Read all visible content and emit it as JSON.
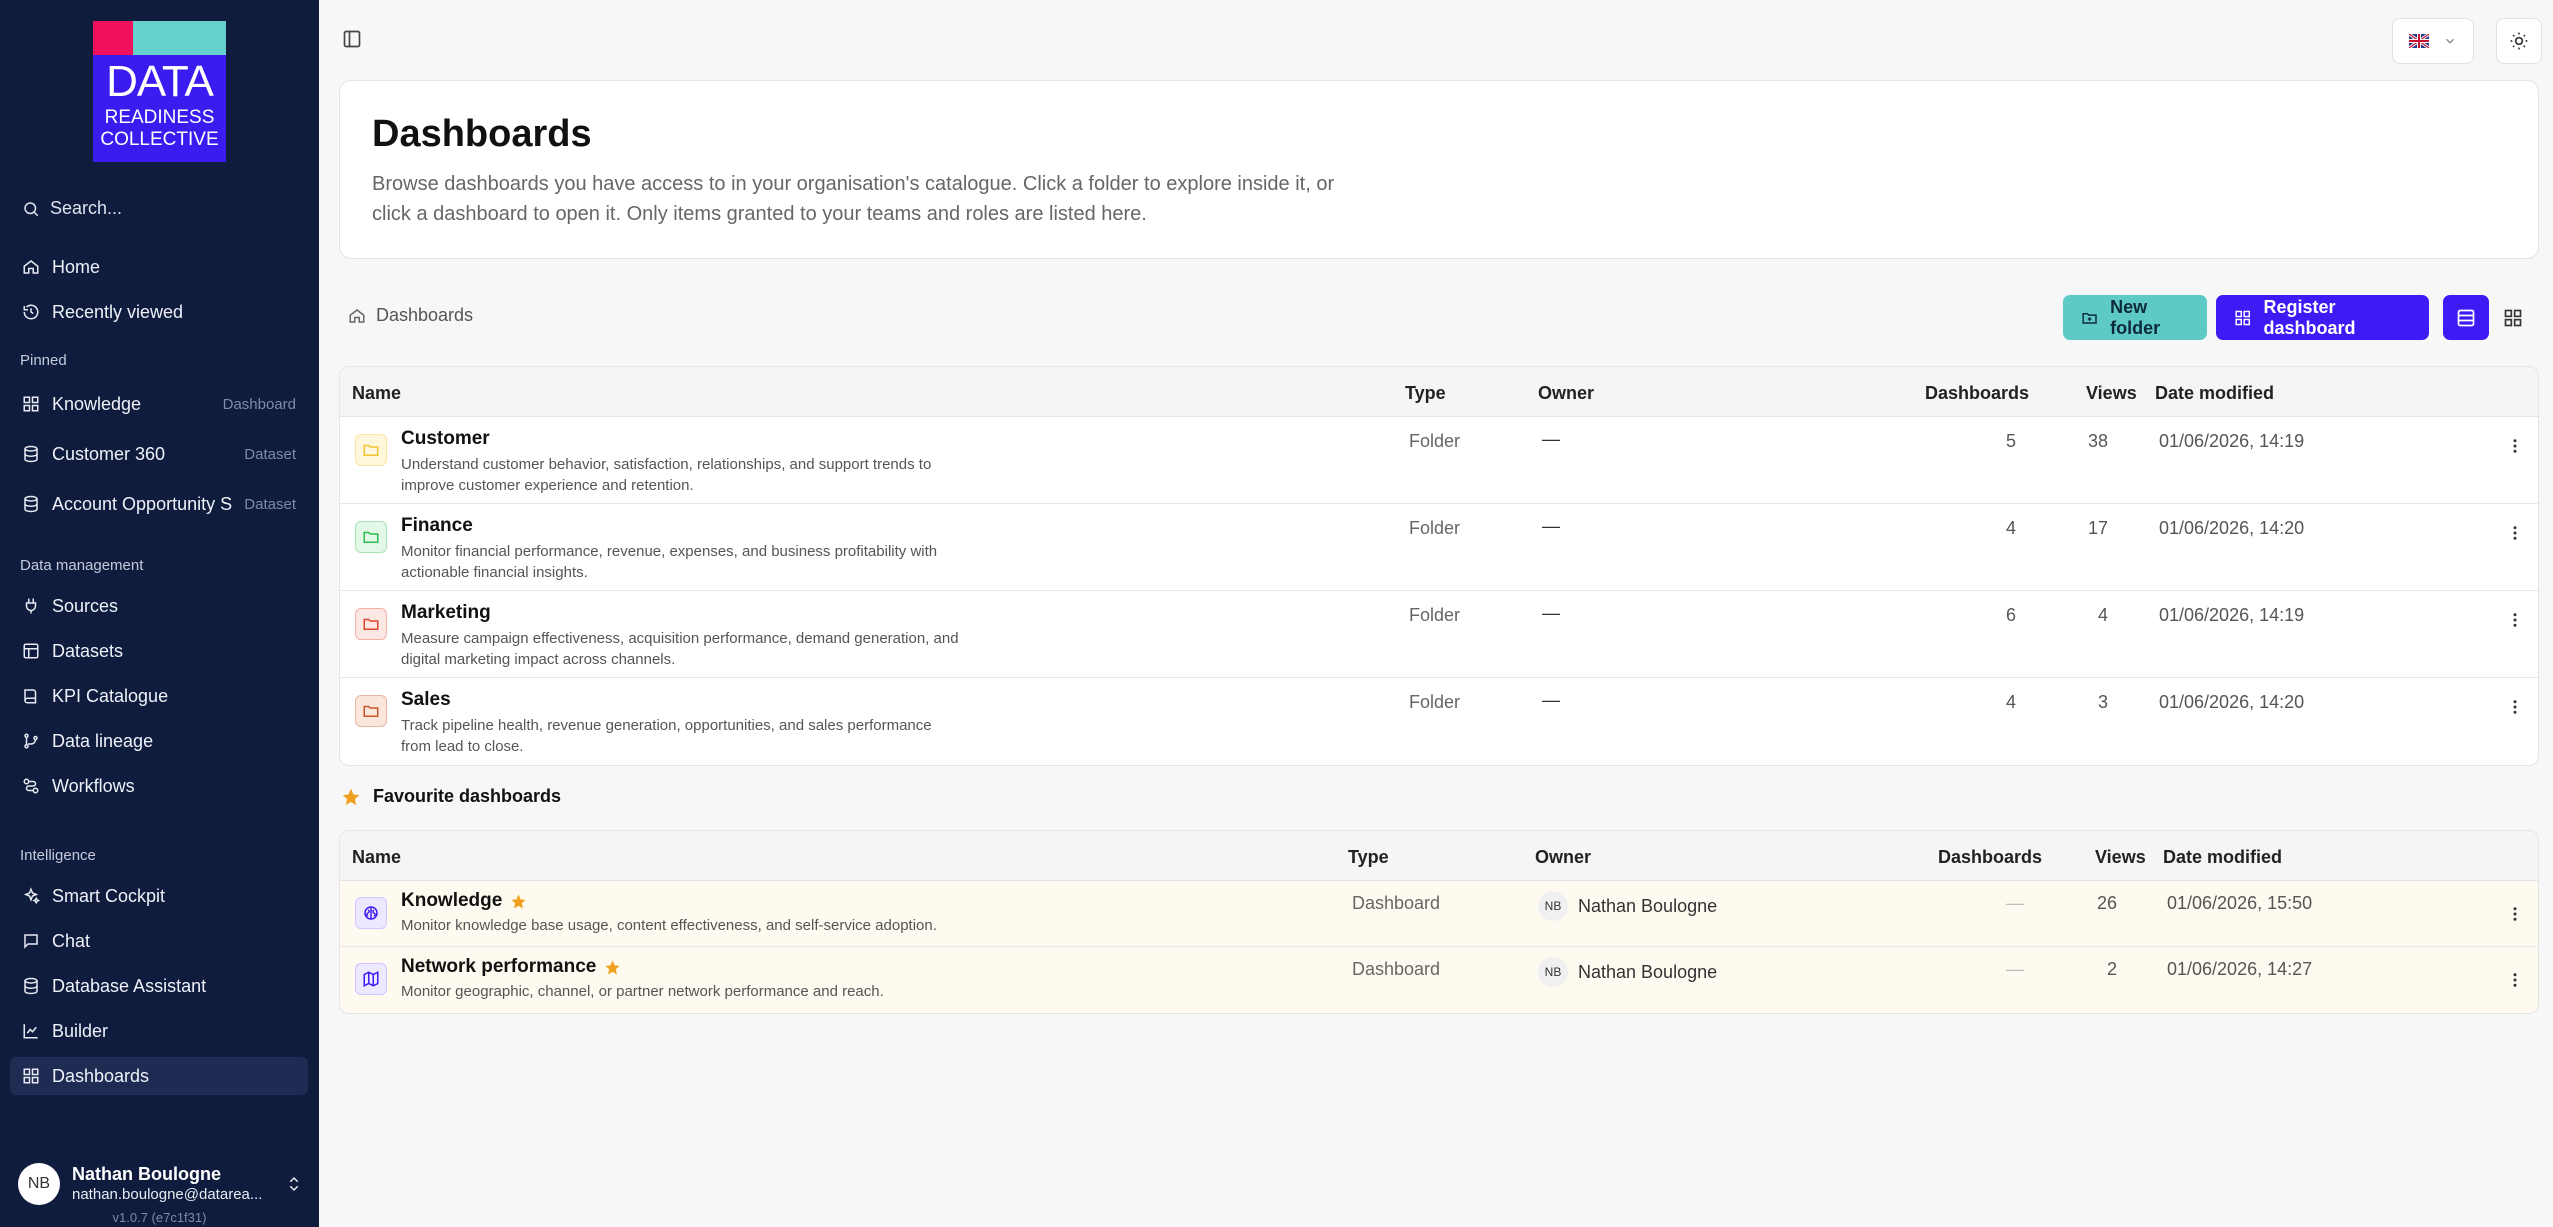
{
  "logo": {
    "line1": "DATA",
    "line2": "READINESS",
    "line3": "COLLECTIVE"
  },
  "sidebar": {
    "search_placeholder": "Search...",
    "top": [
      {
        "label": "Home",
        "icon": "home-icon"
      },
      {
        "label": "Recently viewed",
        "icon": "history-icon"
      }
    ],
    "pinned_label": "Pinned",
    "pinned": [
      {
        "label": "Knowledge",
        "sub": "Dashboard",
        "icon": "dashboard-icon"
      },
      {
        "label": "Customer 360",
        "sub": "Dataset",
        "icon": "database-icon"
      },
      {
        "label": "Account Opportunity S...",
        "sub": "Dataset",
        "icon": "database-icon"
      }
    ],
    "data_mgmt_label": "Data management",
    "data_mgmt": [
      {
        "label": "Sources",
        "icon": "plug-icon"
      },
      {
        "label": "Datasets",
        "icon": "table-icon"
      },
      {
        "label": "KPI Catalogue",
        "icon": "book-icon"
      },
      {
        "label": "Data lineage",
        "icon": "git-branch-icon"
      },
      {
        "label": "Workflows",
        "icon": "workflow-icon"
      }
    ],
    "intelligence_label": "Intelligence",
    "intelligence": [
      {
        "label": "Smart Cockpit",
        "icon": "sparkles-icon"
      },
      {
        "label": "Chat",
        "icon": "chat-icon"
      },
      {
        "label": "Database Assistant",
        "icon": "database-icon"
      },
      {
        "label": "Builder",
        "icon": "chart-icon"
      },
      {
        "label": "Dashboards",
        "icon": "dashboard-icon",
        "active": true
      }
    ],
    "user": {
      "initials": "NB",
      "name": "Nathan Boulogne",
      "email": "nathan.boulogne@datarea..."
    },
    "version": "v1.0.7 (e7c1f31)"
  },
  "header": {
    "title": "Dashboards",
    "description": "Browse dashboards you have access to in your organisation's catalogue. Click a folder to explore inside it, or click a dashboard to open it. Only items granted to your teams and roles are listed here."
  },
  "breadcrumb": "Dashboards",
  "actions": {
    "new_folder": "New folder",
    "register": "Register dashboard"
  },
  "columns": {
    "name": "Name",
    "type": "Type",
    "owner": "Owner",
    "dashboards": "Dashboards",
    "views": "Views",
    "modified": "Date modified"
  },
  "folders": [
    {
      "name": "Customer",
      "desc": "Understand customer behavior, satisfaction, relationships, and support trends to improve customer experience and retention.",
      "type": "Folder",
      "owner": "—",
      "dashboards": "5",
      "views": "38",
      "modified": "01/06/2026, 14:19",
      "color": "#f4c430",
      "bg": "#fff7dc"
    },
    {
      "name": "Finance",
      "desc": "Monitor financial performance, revenue, expenses, and business profitability with actionable financial insights.",
      "type": "Folder",
      "owner": "—",
      "dashboards": "4",
      "views": "17",
      "modified": "01/06/2026, 14:20",
      "color": "#2dbe4f",
      "bg": "#e4f8e8"
    },
    {
      "name": "Marketing",
      "desc": "Measure campaign effectiveness, acquisition performance, demand generation, and digital marketing impact across channels.",
      "type": "Folder",
      "owner": "—",
      "dashboards": "6",
      "views": "4",
      "modified": "01/06/2026, 14:19",
      "color": "#e0452e",
      "bg": "#fde7e3"
    },
    {
      "name": "Sales",
      "desc": "Track pipeline health, revenue generation, opportunities, and sales performance from lead to close.",
      "type": "Folder",
      "owner": "—",
      "dashboards": "4",
      "views": "3",
      "modified": "01/06/2026, 14:20",
      "color": "#c8582a",
      "bg": "#fbe6dc"
    }
  ],
  "favourites_title": "Favourite dashboards",
  "favourites": [
    {
      "name": "Knowledge",
      "desc": "Monitor knowledge base usage, content effectiveness, and self-service adoption.",
      "type": "Dashboard",
      "owner_initials": "NB",
      "owner": "Nathan Boulogne",
      "dashboards": "—",
      "views": "26",
      "modified": "01/06/2026, 15:50",
      "icon": "brain-icon"
    },
    {
      "name": "Network performance",
      "desc": "Monitor geographic, channel, or partner network performance and reach.",
      "type": "Dashboard",
      "owner_initials": "NB",
      "owner": "Nathan Boulogne",
      "dashboards": "—",
      "views": "2",
      "modified": "01/06/2026, 14:27",
      "icon": "map-icon"
    }
  ],
  "colors": {
    "accent": "#3e1af5",
    "teal": "#5ecac6",
    "sidebar": "#101c3d",
    "star": "#f0a020"
  }
}
